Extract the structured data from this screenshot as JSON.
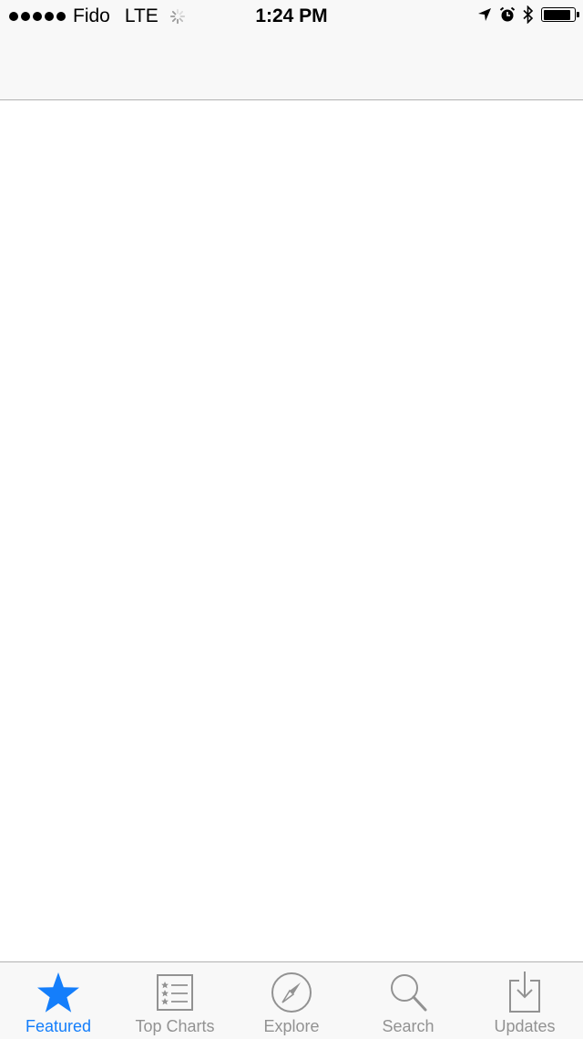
{
  "status_bar": {
    "signal_bars": 5,
    "carrier": "Fido",
    "network": "LTE",
    "time": "1:24 PM",
    "icons": [
      "location-arrow-icon",
      "alarm-icon",
      "bluetooth-icon",
      "battery-icon"
    ],
    "battery_level": 0.9
  },
  "colors": {
    "accent": "#147efb",
    "inactive": "#929292",
    "bar_background": "#f8f8f8"
  },
  "tab_bar": {
    "tabs": [
      {
        "label": "Featured",
        "icon": "star-icon",
        "active": true
      },
      {
        "label": "Top Charts",
        "icon": "top-charts-list-icon",
        "active": false
      },
      {
        "label": "Explore",
        "icon": "compass-icon",
        "active": false
      },
      {
        "label": "Search",
        "icon": "magnifier-icon",
        "active": false
      },
      {
        "label": "Updates",
        "icon": "download-tray-icon",
        "active": false
      }
    ]
  }
}
